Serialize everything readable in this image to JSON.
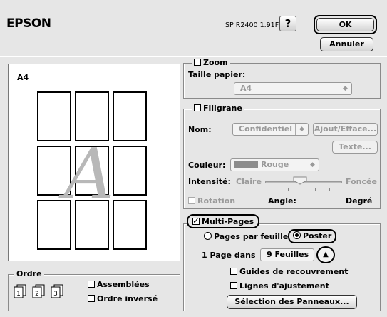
{
  "header": {
    "brand": "EPSON",
    "model": "SP R2400 1.91F",
    "help_label": "?",
    "ok_label": "OK",
    "cancel_label": "Annuler"
  },
  "preview": {
    "paper_label": "A4",
    "watermark_glyph": "A"
  },
  "zoom": {
    "legend": "Zoom",
    "checked": false,
    "paper_size_label": "Taille papier:",
    "paper_size_value": "A4"
  },
  "filigrane": {
    "legend": "Filigrane",
    "checked": false,
    "name_label": "Nom:",
    "name_value": "Confidentiel",
    "add_remove_label": "Ajout/Efface...",
    "text_label": "Texte...",
    "color_label": "Couleur:",
    "color_value": "Rouge",
    "color_swatch": "#8c8c8c",
    "intensity_label": "Intensité:",
    "intensity_low": "Claire",
    "intensity_high": "Foncée",
    "intensity_level": 0.45,
    "rotation_label": "Rotation",
    "angle_label": "Angle:",
    "degree_label": "Degré"
  },
  "multipages": {
    "legend": "Multi-Pages",
    "checked": true,
    "option_pages_per_sheet": "Pages par feuille",
    "option_poster": "Poster",
    "selected_option": "Poster",
    "page_in_label": "1 Page dans",
    "sheets_value": "9 Feuilles",
    "overlap_guides_label": "Guides de recouvrement",
    "overlap_guides_checked": false,
    "trim_lines_label": "Lignes d'ajustement",
    "trim_lines_checked": false,
    "panel_selection_label": "Sélection des Panneaux..."
  },
  "order": {
    "legend": "Ordre",
    "collated_label": "Assemblées",
    "collated_checked": false,
    "reverse_label": "Ordre inversé",
    "reverse_checked": false,
    "icon_numbers": [
      "1",
      "2",
      "3"
    ]
  }
}
